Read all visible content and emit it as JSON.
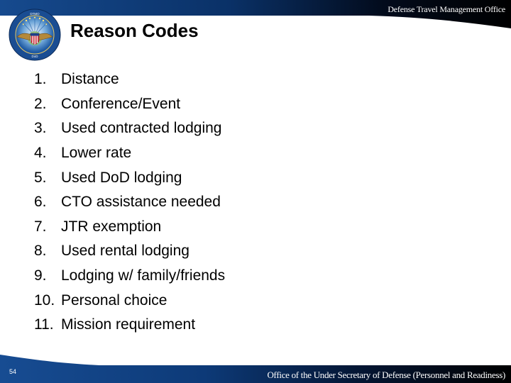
{
  "header": {
    "organization": "Defense Travel Management Office",
    "seal_icon": "dod-seal-icon"
  },
  "slide": {
    "title": "Reason Codes",
    "items": [
      {
        "number": "1.",
        "label": "Distance"
      },
      {
        "number": "2.",
        "label": "Conference/Event"
      },
      {
        "number": "3.",
        "label": "Used contracted lodging"
      },
      {
        "number": "4.",
        "label": "Lower rate"
      },
      {
        "number": "5.",
        "label": "Used DoD lodging"
      },
      {
        "number": "6.",
        "label": "CTO assistance needed"
      },
      {
        "number": "7.",
        "label": "JTR exemption"
      },
      {
        "number": "8.",
        "label": "Used rental lodging"
      },
      {
        "number": "9.",
        "label": "Lodging w/ family/friends"
      },
      {
        "number": "10.",
        "label": "Personal choice"
      },
      {
        "number": "11.",
        "label": "Mission requirement"
      }
    ]
  },
  "footer": {
    "page_number": "54",
    "organization": "Office of the Under Secretary of Defense (Personnel and Readiness)"
  },
  "colors": {
    "brand_blue": "#0d3f7e",
    "dark": "#000000",
    "text": "#000000",
    "background": "#ffffff"
  }
}
